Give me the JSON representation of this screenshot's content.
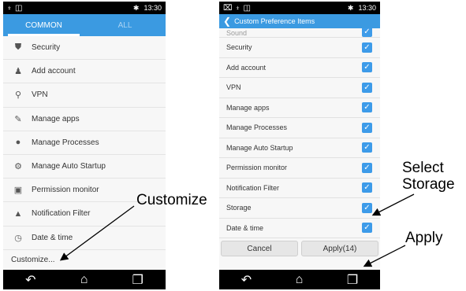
{
  "left_screen": {
    "status": {
      "left_icons": [
        "usb-icon",
        "android-icon",
        "bag-icon"
      ],
      "bluetooth": "✱",
      "time": "13:30"
    },
    "tabs": [
      {
        "label": "COMMON",
        "active": true
      },
      {
        "label": "ALL",
        "active": false
      }
    ],
    "items": [
      {
        "label": "Security",
        "icon": "shield-icon",
        "glyph": "⛊"
      },
      {
        "label": "Add account",
        "icon": "person-add-icon",
        "glyph": "♟"
      },
      {
        "label": "VPN",
        "icon": "vpn-icon",
        "glyph": "⚲"
      },
      {
        "label": "Manage apps",
        "icon": "wrench-icon",
        "glyph": "✎"
      },
      {
        "label": "Manage Processes",
        "icon": "processes-icon",
        "glyph": "●"
      },
      {
        "label": "Manage Auto Startup",
        "icon": "gear-icon",
        "glyph": "⚙"
      },
      {
        "label": "Permission monitor",
        "icon": "image-icon",
        "glyph": "▣"
      },
      {
        "label": "Notification Filter",
        "icon": "filter-icon",
        "glyph": "▲"
      },
      {
        "label": "Date & time",
        "icon": "clock-icon",
        "glyph": "◷"
      }
    ],
    "customize_label": "Customize..."
  },
  "right_screen": {
    "status": {
      "left_icons": [
        "picture-icon",
        "android-icon",
        "bag-icon"
      ],
      "bluetooth": "✱",
      "time": "13:30"
    },
    "title": "Custom Preference Items",
    "partial_item": "Sound",
    "items": [
      {
        "label": "Security",
        "checked": true
      },
      {
        "label": "Add account",
        "checked": true
      },
      {
        "label": "VPN",
        "checked": true
      },
      {
        "label": "Manage apps",
        "checked": true
      },
      {
        "label": "Manage Processes",
        "checked": true
      },
      {
        "label": "Manage Auto Startup",
        "checked": true
      },
      {
        "label": "Permission monitor",
        "checked": true
      },
      {
        "label": "Notification Filter",
        "checked": true
      },
      {
        "label": "Storage",
        "checked": true
      },
      {
        "label": "Date & time",
        "checked": true
      }
    ],
    "buttons": {
      "cancel": "Cancel",
      "apply": "Apply(14)"
    }
  },
  "nav": {
    "back": "↶",
    "home": "⌂",
    "recent": "❐"
  },
  "annotations": {
    "customize": "Customize",
    "select_line1": "Select",
    "select_line2": "Storage",
    "apply": "Apply"
  },
  "colors": {
    "accent": "#3b9ae1",
    "checkbox": "#3d9be9"
  }
}
